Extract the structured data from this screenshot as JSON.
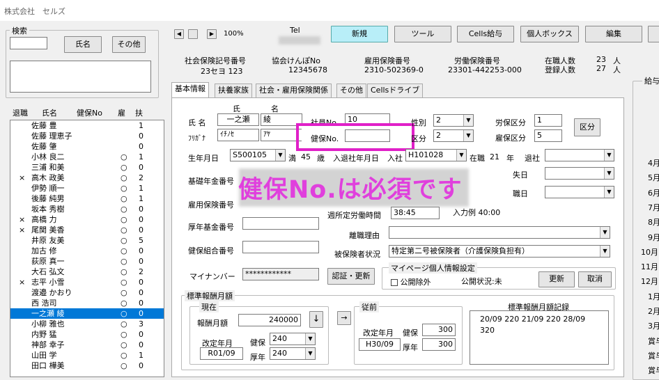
{
  "title": "株式会社　セルズ",
  "search": {
    "label": "検索",
    "name_btn": "氏名",
    "other_btn": "その他"
  },
  "list": {
    "headers": [
      "退職",
      "氏名",
      "健保No",
      "雇",
      "扶"
    ],
    "rows": [
      {
        "x": "",
        "name": "佐藤 豊",
        "c1": "",
        "c2": "1"
      },
      {
        "x": "",
        "name": "佐藤 理恵子",
        "c1": "",
        "c2": "0"
      },
      {
        "x": "",
        "name": "佐藤 肇",
        "c1": "",
        "c2": "0"
      },
      {
        "x": "",
        "name": "小林 良二",
        "c1": "○",
        "c2": "1"
      },
      {
        "x": "",
        "name": "三浦 和美",
        "c1": "○",
        "c2": "0"
      },
      {
        "x": "×",
        "name": "高木 政美",
        "c1": "○",
        "c2": "2"
      },
      {
        "x": "",
        "name": "伊勢 順一",
        "c1": "○",
        "c2": "1"
      },
      {
        "x": "",
        "name": "後藤 純男",
        "c1": "○",
        "c2": "1"
      },
      {
        "x": "",
        "name": "坂本 秀樹",
        "c1": "○",
        "c2": "0"
      },
      {
        "x": "×",
        "name": "高橋 力",
        "c1": "○",
        "c2": "0"
      },
      {
        "x": "×",
        "name": "尾関 美香",
        "c1": "○",
        "c2": "0"
      },
      {
        "x": "",
        "name": "井原 友美",
        "c1": "○",
        "c2": "5"
      },
      {
        "x": "",
        "name": "加古 修",
        "c1": "○",
        "c2": "0"
      },
      {
        "x": "",
        "name": "荻原 真一",
        "c1": "○",
        "c2": "0"
      },
      {
        "x": "",
        "name": "大石 弘文",
        "c1": "○",
        "c2": "2"
      },
      {
        "x": "×",
        "name": "志平 小雪",
        "c1": "○",
        "c2": "0"
      },
      {
        "x": "",
        "name": "渡邉 かおり",
        "c1": "○",
        "c2": "0"
      },
      {
        "x": "",
        "name": "西 浩司",
        "c1": "○",
        "c2": "0"
      },
      {
        "x": "",
        "name": "一之瀬 綾",
        "c1": "○",
        "c2": "0",
        "sel": true
      },
      {
        "x": "",
        "name": "小柳 雅也",
        "c1": "○",
        "c2": "3"
      },
      {
        "x": "",
        "name": "内野 猛",
        "c1": "○",
        "c2": "0"
      },
      {
        "x": "",
        "name": "神部 幸子",
        "c1": "○",
        "c2": "0"
      },
      {
        "x": "",
        "name": "山田 学",
        "c1": "○",
        "c2": "1"
      },
      {
        "x": "",
        "name": "田口 樺美",
        "c1": "○",
        "c2": "0"
      }
    ]
  },
  "toolbar": {
    "zoom": "100%",
    "tel": "Tel",
    "new": "新規",
    "tools": "ツール",
    "cells_pay": "Cells給与",
    "personal_box": "個人ボックス",
    "edit": "編集"
  },
  "info": {
    "shaho_label": "社会保険記号番号",
    "shaho_val": "23セヨ 123",
    "kyokai_label": "協会けんぽNo",
    "kyokai_val": "12345678",
    "koyo_label": "雇用保険番号",
    "koyo_val": "2310-502369-0",
    "rodo_label": "労働保険番号",
    "rodo_val": "23301-442253-000",
    "zaishoku_label": "在職人数",
    "zaishoku_val": "23",
    "zaishoku_unit": "人",
    "toroku_label": "登録人数",
    "toroku_val": "27",
    "toroku_unit": "人"
  },
  "tabs": [
    "基本情報",
    "扶養家族",
    "社会・雇用保険関係",
    "その他",
    "Cellsドライブ"
  ],
  "form": {
    "shimei": "氏 名",
    "furigana": "ﾌﾘｶﾞﾅ",
    "sei_hdr": "氏",
    "mei_hdr": "名",
    "sei": "一之瀬",
    "mei": "綾",
    "sei_kana": "ｲﾁﾉｾ",
    "mei_kana": "ｱﾔ",
    "shain_lbl": "社員No",
    "shain_val": "10",
    "kenpo_lbl": "健保No.",
    "seibetsu_lbl": "性別",
    "seibetsu_val": "2",
    "kubun_lbl": "区分",
    "kubun_val": "2",
    "rohoku_lbl": "労保区分",
    "rohoku_val": "1",
    "koyoku_lbl": "雇保区分",
    "koyoku_val": "5",
    "kubun_btn": "区分",
    "birth_lbl": "生年月日",
    "birth_val": "S500105",
    "man": "満",
    "age": "45",
    "sai": "歳",
    "nyutai_lbl": "入退社年月日",
    "nyusha": "入社",
    "nyusha_val": "H101028",
    "zaishoku": "在職",
    "zaishoku_yrs": "21",
    "nen": "年",
    "taisha": "退社",
    "kiso_lbl": "基礎年金番号",
    "koyo_lbl": "雇用保険番号",
    "kosei_lbl": "厚年基金番号",
    "kenkumi_lbl": "健保組合番号",
    "mynumber_lbl": "マイナンバー",
    "mynumber_val": "************",
    "ninsho_btn": "認証・更新",
    "shokentei_lbl": "週所定労働時間",
    "shokentei_val": "38:45",
    "nyuryoku": "入力例  40:00",
    "rishoku_lbl": "離職理由",
    "hihoken_lbl": "被保険者状況",
    "hihoken_val": "特定第二号被保険者（介護保険負担有）",
    "mypage_grp": "マイページ個人情報設定",
    "kokai_jogai": "公開除外",
    "kokai_status": "公開状況:未",
    "koshin_btn": "更新",
    "cancel_btn": "取消",
    "hyojun_grp": "標準報酬月額",
    "genzai_grp": "現在",
    "hoshu_lbl": "報酬月額",
    "hoshu_val": "240000",
    "kaitei_lbl": "改定年月",
    "kaitei_val": "R01/09",
    "kenpo2": "健保",
    "kenpo2_val": "240",
    "kounen": "厚年",
    "kounen_val": "240",
    "juzen_grp": "従前",
    "juzen_kaitei_lbl": "改定年月",
    "juzen_kaitei_val": "H30/09",
    "juzen_kenpo": "健保",
    "juzen_kenpo_val": "300",
    "juzen_kounen": "厚年",
    "juzen_kounen_val": "300",
    "kiroku_grp": "標準報酬月額記録",
    "kiroku_val": "20/09 220 21/09 220 28/09 320",
    "kenpo_date1": "失日",
    "kenpo_date2": "職日"
  },
  "right_panel": {
    "title": "給与",
    "months": [
      "4月",
      "5月",
      "6月",
      "7月",
      "8月",
      "9月",
      "10月",
      "11月",
      "12月",
      "1月",
      "2月",
      "3月",
      "賞与",
      "賞与",
      "賞与"
    ]
  },
  "overlay": "健保No.は必須です"
}
